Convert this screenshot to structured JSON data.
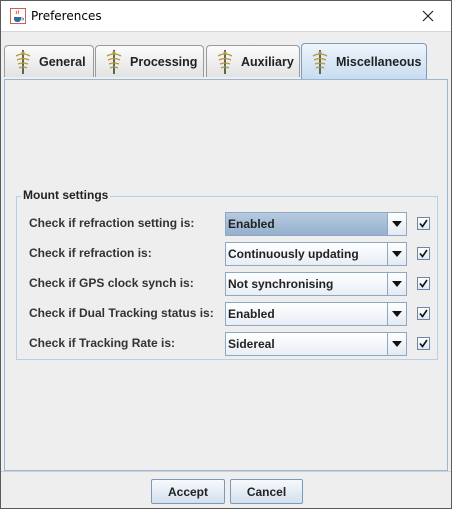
{
  "window": {
    "title": "Preferences"
  },
  "tabs": [
    {
      "label": "General",
      "icon": "app-logo-icon",
      "active": false
    },
    {
      "label": "Processing",
      "icon": "app-logo-icon",
      "active": false
    },
    {
      "label": "Auxiliary",
      "icon": "app-logo-icon",
      "active": false
    },
    {
      "label": "Miscellaneous",
      "icon": "app-logo-icon",
      "active": true
    }
  ],
  "mount_settings": {
    "title": "Mount settings",
    "rows": [
      {
        "label": "Check if refraction setting is:",
        "value": "Enabled",
        "checked": true
      },
      {
        "label": "Check if refraction is:",
        "value": "Continuously updating",
        "checked": true
      },
      {
        "label": "Check if GPS clock synch is:",
        "value": "Not synchronising",
        "checked": true
      },
      {
        "label": "Check if Dual Tracking status is:",
        "value": "Enabled",
        "checked": true
      },
      {
        "label": "Check if Tracking Rate is:",
        "value": "Sidereal",
        "checked": true
      }
    ]
  },
  "buttons": {
    "accept": "Accept",
    "cancel": "Cancel"
  },
  "colors": {
    "active_tab": "#c8dcf0",
    "highlight_combo": "#a4bdd6",
    "border_accent": "#7a9cc0"
  }
}
